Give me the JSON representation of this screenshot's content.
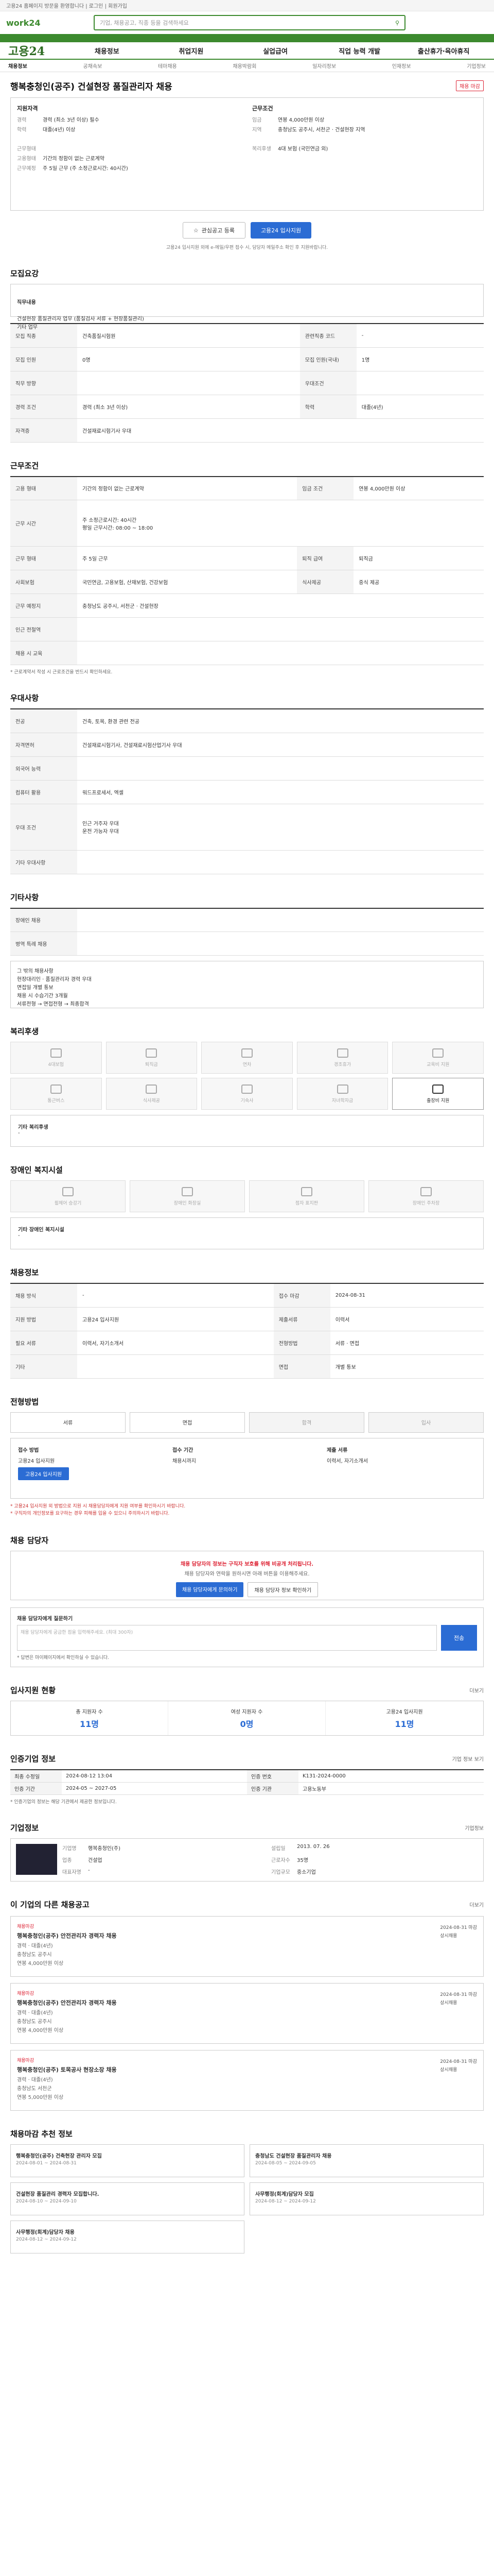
{
  "topbar": {
    "text": "고용24 홈페이지 방문을 환영합니다 | 로그인 | 회원가입"
  },
  "header": {
    "logo": "work24",
    "search_placeholder": "기업, 채용공고, 직종 등을 검색하세요",
    "search_icon": "search-icon"
  },
  "gnb": {
    "logo": "고용24",
    "items": [
      "채용정보",
      "취업지원",
      "실업급여",
      "직업 능력 개발",
      "출산휴가·육아휴직"
    ]
  },
  "subnav": {
    "items": [
      "채용정보",
      "공채속보",
      "테마채용",
      "채용박람회",
      "일자리정보",
      "인재정보",
      "기업정보"
    ],
    "active": "채용정보"
  },
  "job": {
    "title": "행복충청인(공주) 건설현장 품질관리자 채용",
    "status": "채용 마감",
    "summary": {
      "left_title": "지원자격",
      "left": [
        {
          "k": "경력",
          "v": "경력 (최소 3년 이상) 필수"
        },
        {
          "k": "학력",
          "v": "대졸(4년) 이상"
        },
        {
          "k": "근무형태",
          "v": ""
        },
        {
          "k": "고용형태",
          "v": "기간의 정함이 없는 근로계약"
        },
        {
          "k": "근무예정",
          "v": "주 5일 근무 (주 소정근로시간: 40시간)"
        }
      ],
      "right_title": "근무조건",
      "right": [
        {
          "k": "임금",
          "v": "연봉 4,000만원 이상"
        },
        {
          "k": "지역",
          "v": "충청남도 공주시, 서천군 · 건설현장 지역"
        },
        {
          "k": "복리후생",
          "v": "4대 보험 (국민연금 외)"
        }
      ]
    },
    "actions": {
      "interest": "관심공고 등록",
      "apply": "고용24 입사지원"
    },
    "notice": "고용24 입사지원 외에 e-메일/우편 접수 시, 담당자 메일주소 확인 후 지원바랍니다."
  },
  "recruit": {
    "title": "모집요강",
    "duty_label": "직무내용",
    "duty": "건설현장 품질관리자 업무 (품질검사 서류 + 현장품질관리)\n기타 업무",
    "rows": [
      {
        "k": "모집 직종",
        "v": "건축품질시험원",
        "k2": "관련직종 코드",
        "v2": "-"
      },
      {
        "k": "모집 인원",
        "v": "0명",
        "k2": "모집 인원(국내)",
        "v2": "1명"
      },
      {
        "k": "직무 방향",
        "v": "",
        "k2": "우대조건",
        "v2": ""
      },
      {
        "k": "경력 조건",
        "v": "경력 (최소 3년 이상)",
        "k2": "학력",
        "v2": "대졸(4년)"
      },
      {
        "k": "자격증",
        "v": "건설재료시험기사 우대",
        "k2": "",
        "v2": ""
      }
    ]
  },
  "work": {
    "title": "근무조건",
    "rows": [
      {
        "k": "고용 형태",
        "v": "기간의 정함이 없는 근로계약",
        "k2": "임금 조건",
        "v2": "연봉 4,000만원 이상"
      },
      {
        "k": "근무 시간",
        "v": "주 소정근로시간: 40시간\n평일 근무시간: 08:00 ~ 18:00",
        "k2": "",
        "v2": ""
      },
      {
        "k": "근무 형태",
        "v": "주 5일 근무",
        "k2": "퇴직 급여",
        "v2": "퇴직금"
      },
      {
        "k": "사회보험",
        "v": "국민연금, 고용보험, 산재보험, 건강보험",
        "k2": "식사제공",
        "v2": "중식 제공"
      },
      {
        "k": "근무 예정지",
        "v": "충청남도 공주시, 서천군 · 건설현장",
        "k2": "",
        "v2": ""
      },
      {
        "k": "인근 전철역",
        "v": "",
        "k2": "",
        "v2": ""
      },
      {
        "k": "채용 시 교육",
        "v": "",
        "k2": "",
        "v2": ""
      }
    ],
    "note": "* 근로계약서 작성 시 근로조건을 반드시 확인하세요."
  },
  "qual": {
    "title": "우대사항",
    "rows": [
      {
        "k": "전공",
        "v": "건축, 토목, 환경 관련 전공"
      },
      {
        "k": "자격면허",
        "v": "건설재료시험기사, 건설재료시험산업기사 우대"
      },
      {
        "k": "외국어 능력",
        "v": ""
      },
      {
        "k": "컴퓨터 활용",
        "v": "워드프로세서, 엑셀"
      },
      {
        "k": "우대 조건",
        "v": "인근 거주자 우대\n운전 가능자 우대"
      },
      {
        "k": "기타 우대사항",
        "v": ""
      }
    ]
  },
  "etc": {
    "title": "기타사항",
    "rows": [
      {
        "k": "장애인 채용",
        "v": ""
      },
      {
        "k": "병역 특례 채용",
        "v": ""
      }
    ],
    "extra": "그 밖의 채용사항\n현장대리인 · 품질관리자 경력 우대\n면접일 개별 통보\n채용 시 수습기간 3개월\n서류전형 → 면접전형 → 최종합격"
  },
  "welfare": {
    "title": "복리후생",
    "items": [
      {
        "label": "4대보험",
        "on": false
      },
      {
        "label": "퇴직금",
        "on": false
      },
      {
        "label": "연차",
        "on": false
      },
      {
        "label": "경조휴가",
        "on": false
      },
      {
        "label": "교육비 지원",
        "on": false
      },
      {
        "label": "통근버스",
        "on": false
      },
      {
        "label": "식사제공",
        "on": false
      },
      {
        "label": "기숙사",
        "on": false
      },
      {
        "label": "자녀학자금",
        "on": false
      },
      {
        "label": "출장비 지원",
        "on": true
      }
    ],
    "etc_label": "기타 복리후생",
    "etc_value": "-"
  },
  "disabled": {
    "title": "장애인 복지시설",
    "items": [
      "휠체어 승강기",
      "장애인 화장실",
      "점자 표지판",
      "장애인 주차장"
    ],
    "etc_label": "기타 장애인 복지시설",
    "etc_value": "-"
  },
  "recruit_process": {
    "title": "채용정보",
    "rows": [
      {
        "k": "채용 방식",
        "v": "-"
      },
      {
        "k": "지원 방법",
        "v": "고용24 입사지원"
      },
      {
        "k": "필요 서류",
        "v": "이력서, 자기소개서"
      },
      {
        "k": "기타",
        "v": ""
      }
    ],
    "k2": [
      "접수 마감",
      "제출서류",
      "전형방법",
      "면접"
    ],
    "v2": [
      "2024-08-31",
      "이력서",
      "서류 · 면접",
      "개별 통보"
    ]
  },
  "procedure": {
    "title": "전형방법",
    "steps": [
      "서류",
      "면접",
      "합격",
      "입사"
    ],
    "apply_title": "접수 방법",
    "apply_method": "고용24 입사지원",
    "apply_btn": "고용24 입사지원",
    "period_title": "접수 기간",
    "period": "채용시까지",
    "doc_title": "제출 서류",
    "doc": "이력서, 자기소개서",
    "warning": "* 고용24 입사지원 외 방법으로 지원 시 채용담당자에게 지원 여부를 확인하시기 바랍니다.\n* 구직자의 개인정보를 요구하는 경우 피해를 입을 수 있으니 주의하시기 바랍니다."
  },
  "manager": {
    "title": "채용 담당자",
    "notice": "채용 담당자의 정보는 구직자 보호를 위해 비공개 처리됩니다.",
    "sub": "채용 담당자와 연락을 원하시면 아래 버튼을 이용해주세요.",
    "btn1": "채용 담당자에게 문의하기",
    "btn2": "채용 담당자 정보 확인하기",
    "qa_title": "채용 담당자에게 질문하기",
    "qa_placeholder": "채용 담당자에게 궁금한 점을 입력해주세요. (최대 300자)",
    "qa_send": "전송",
    "qa_note": "* 답변은 마이페이지에서 확인하실 수 있습니다."
  },
  "apply_status": {
    "title": "입사지원 현황",
    "more": "더보기",
    "cells": [
      {
        "label": "총 지원자 수",
        "num": "11명"
      },
      {
        "label": "여성 지원자 수",
        "num": "0명"
      },
      {
        "label": "고용24 입사지원",
        "num": "11명"
      }
    ]
  },
  "recruit_info": {
    "title": "인증기업 정보",
    "more": "기업 정보 보기",
    "rows": [
      {
        "k": "최종 수정일",
        "v": "2024-08-12 13:04",
        "k2": "인증 번호",
        "v2": "K131-2024-0000"
      },
      {
        "k": "인증 기간",
        "v": "2024-05 ~ 2027-05",
        "k2": "인증 기관",
        "v2": "고용노동부"
      }
    ],
    "note": "* 인증기업의 정보는 해당 기관에서 제공한 정보입니다."
  },
  "company": {
    "title": "기업정보",
    "more": "기업정보",
    "rows": [
      {
        "k": "기업명",
        "v": "행복충청인(주)"
      },
      {
        "k": "설립일",
        "v": "2013. 07. 26"
      },
      {
        "k": "업종",
        "v": "건설업"
      },
      {
        "k": "근로자수",
        "v": "35명"
      },
      {
        "k": "대표자명",
        "v": "-"
      },
      {
        "k": "기업규모",
        "v": "중소기업"
      }
    ]
  },
  "related": {
    "title": "이 기업의 다른 채용공고",
    "more": "더보기",
    "jobs": [
      {
        "tag": "채용마감",
        "title": "행복충청인(공주) 안전관리자 경력자 채용",
        "meta": "경력 · 대졸(4년)\n충청남도 공주시\n연봉 4,000만원 이상",
        "side": "2024-08-31 마감\n상시채용"
      },
      {
        "tag": "채용마감",
        "title": "행복충청인(공주) 안전관리자 경력자 채용",
        "meta": "경력 · 대졸(4년)\n충청남도 공주시\n연봉 4,000만원 이상",
        "side": "2024-08-31 마감\n상시채용"
      },
      {
        "tag": "채용마감",
        "title": "행복충청인(공주) 토목공사 현장소장 채용",
        "meta": "경력 · 대졸(4년)\n충청남도 서천군\n연봉 5,000만원 이상",
        "side": "2024-08-31 마감\n상시채용"
      }
    ]
  },
  "news": {
    "title": "채용마감 추천 정보",
    "items": [
      {
        "title": "행복충청인(공주) 건축현장 관리자 모집",
        "d": "2024-08-01 ~ 2024-08-31"
      },
      {
        "title": "충청남도 건설현장 품질관리자 채용",
        "d": "2024-08-05 ~ 2024-09-05"
      },
      {
        "title": "건설현장 품질관리 경력자 모집합니다.",
        "d": "2024-08-10 ~ 2024-09-10"
      },
      {
        "title": "사무행정(회계)담당자 모집",
        "d": "2024-08-12 ~ 2024-09-12"
      },
      {
        "title": "사무행정(회계)담당자 채용",
        "d": "2024-08-12 ~ 2024-09-12"
      }
    ]
  }
}
